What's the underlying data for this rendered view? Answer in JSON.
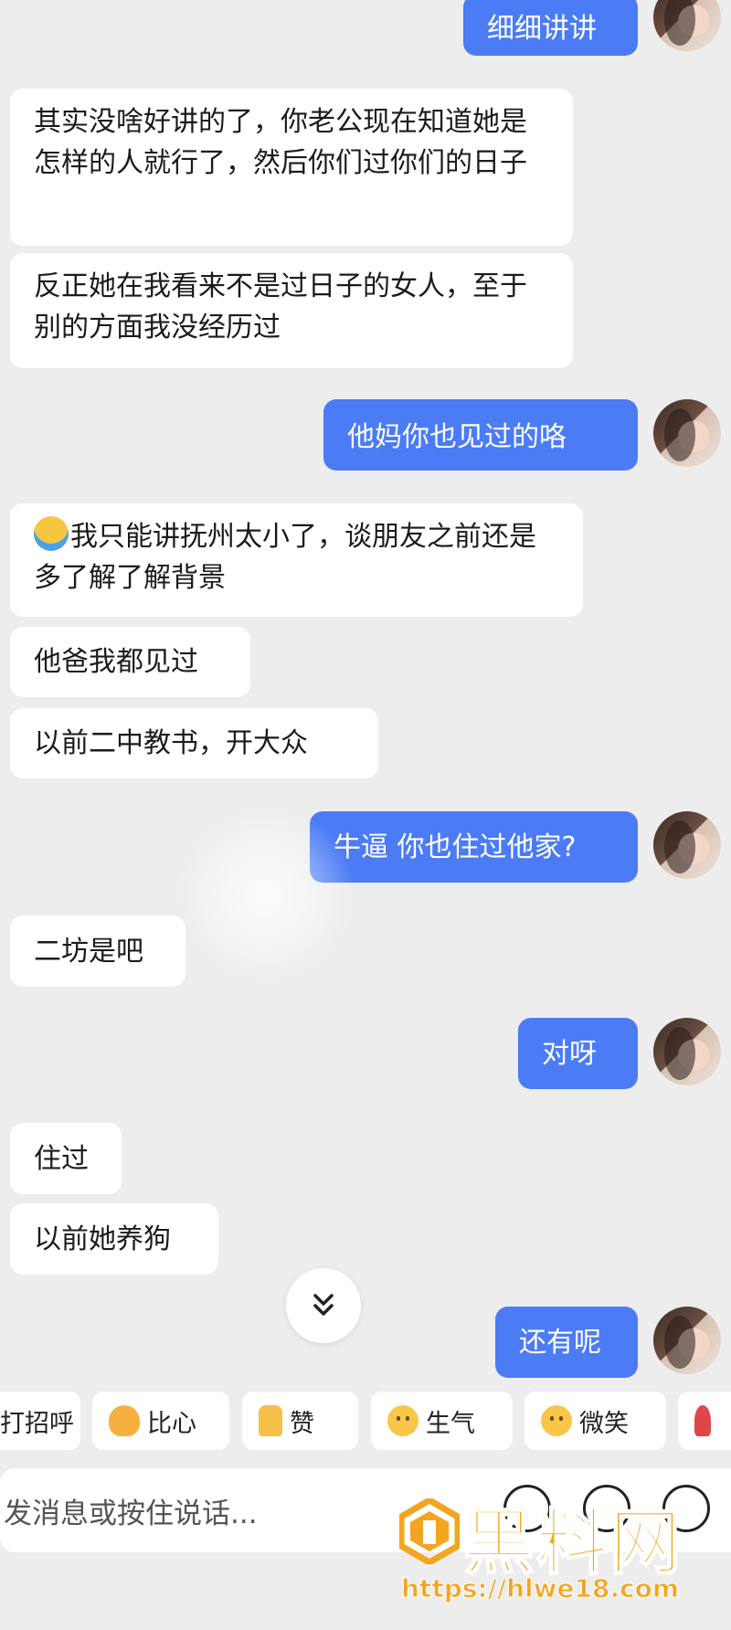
{
  "messages": [
    {
      "dir": "out",
      "text": "细细讲讲"
    },
    {
      "dir": "in",
      "text": "其实没啥好讲的了，你老公现在知道她是怎样的人就行了，然后你们过你们的日子"
    },
    {
      "dir": "in",
      "text": "反正她在我看来不是过日子的女人，至于别的方面我没经历过"
    },
    {
      "dir": "out",
      "text": "他妈你也见过的咯"
    },
    {
      "dir": "in",
      "text": "我只能讲抚州太小了，谈朋友之前还是多了解了解背景",
      "emoji": "laughing-crying-emoji"
    },
    {
      "dir": "in",
      "text": "他爸我都见过"
    },
    {
      "dir": "in",
      "text": "以前二中教书，开大众"
    },
    {
      "dir": "out",
      "text": "牛逼 你也住过他家?"
    },
    {
      "dir": "in",
      "text": "二坊是吧"
    },
    {
      "dir": "out",
      "text": "对呀"
    },
    {
      "dir": "in",
      "text": "住过"
    },
    {
      "dir": "in",
      "text": "以前她养狗"
    },
    {
      "dir": "out",
      "text": "还有呢"
    }
  ],
  "quick_replies": [
    {
      "label": "打招呼",
      "icon": "wave-icon"
    },
    {
      "label": "比心",
      "icon": "heart-hands-icon"
    },
    {
      "label": "赞",
      "icon": "thumbs-up-icon"
    },
    {
      "label": "生气",
      "icon": "angry-face-icon"
    },
    {
      "label": "微笑",
      "icon": "smile-face-icon"
    },
    {
      "label": "",
      "icon": "rose-icon"
    }
  ],
  "input": {
    "placeholder": "发消息或按住说话..."
  },
  "watermark": {
    "title": "黑料网",
    "url": "https://hlwe18.com"
  },
  "colors": {
    "outgoing": "#4b7cf6",
    "incoming": "#ffffff",
    "background": "#ededed",
    "watermark": "#f3a51f"
  }
}
